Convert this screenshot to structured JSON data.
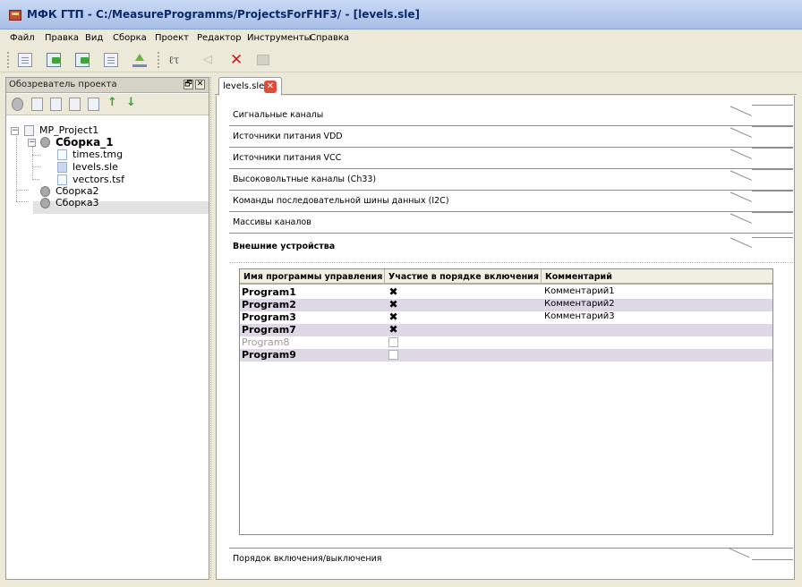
{
  "window": {
    "title": "МФК ГТП   - C:/MeasureProgramms/ProjectsForFHF3/ - [levels.sle]",
    "app_icon": "app-icon"
  },
  "menu": [
    "Файл",
    "Правка",
    "Вид",
    "Сборка",
    "Проект",
    "Редактор",
    "Инструменты",
    "Справка"
  ],
  "toolbar": {
    "icons": [
      "page-icon",
      "green-arrow-icon",
      "green-arrow-icon",
      "page-icon",
      "upload-icon",
      "text-icon",
      "back-icon",
      "delete-icon",
      "disabled-icon"
    ],
    "text_button": "ℓτ",
    "delete_glyph": "✕",
    "back_glyph": "◁"
  },
  "project_explorer": {
    "title": "Обозреватель проекта",
    "restore_glyph": "🗗",
    "close_glyph": "✕",
    "tool_icons": [
      "gear-icon",
      "page-icon",
      "page-icon",
      "page-icon",
      "page-icon",
      "arrow-up-icon",
      "arrow-down-icon"
    ],
    "arrow_up": "↑",
    "arrow_down": "↓",
    "expand_minus": "−",
    "tree": {
      "project": "MP_Project1",
      "assembly1": "Сборка_1",
      "files": [
        "times.tmg",
        "levels.sle",
        "vectors.tsf"
      ],
      "assembly2": "Сборка2",
      "assembly3": "Сборка3"
    }
  },
  "editor": {
    "tab_label": "levels.sle",
    "tab_close": "✕",
    "sections": [
      "Сигнальные каналы",
      "Источники питания VDD",
      "Источники питания VCC",
      "Высоковольтные каналы (Ch33)",
      "Команды последовательной шины данных (I2C)",
      "Массивы каналов"
    ],
    "active_section": "Внешние устройства",
    "bottom_section": "Порядок включения/выключения",
    "table": {
      "headers": [
        "Имя программы управления",
        "Участие в порядке включения",
        "Комментарий"
      ],
      "rows": [
        {
          "name": "Program1",
          "checked": "✖",
          "comment": "Комментарий1"
        },
        {
          "name": "Program2",
          "checked": "✖",
          "comment": "Комментарий2"
        },
        {
          "name": "Program3",
          "checked": "✖",
          "comment": "Комментарий3"
        },
        {
          "name": "Program7",
          "checked": "✖",
          "comment": ""
        },
        {
          "name": "Program8",
          "checked": "",
          "comment": ""
        },
        {
          "name": "Program9",
          "checked": "",
          "comment": ""
        }
      ]
    }
  }
}
